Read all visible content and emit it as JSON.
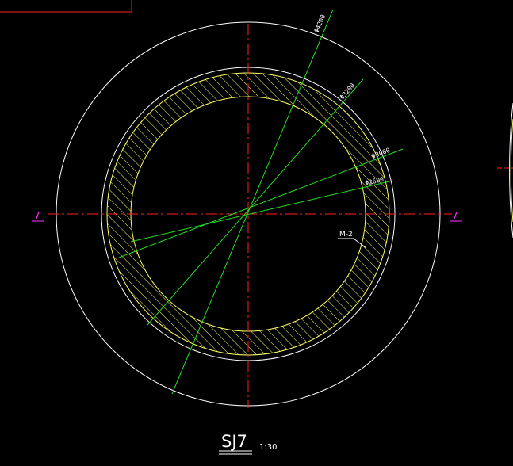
{
  "drawing": {
    "title": "SJ7",
    "scale": "1:30",
    "section_mark_left": "7",
    "section_mark_right": "7",
    "material_label": "M-2",
    "dimension_labels": [
      "Φ4200",
      "Φ3200",
      "Φ3000",
      "Φ2600"
    ]
  },
  "colors": {
    "background": "#000000",
    "circle_outline": "#ffffff",
    "wall_hatch": "#ffff66",
    "centerline": "#ff2020",
    "dimension_line": "#22dd22",
    "section_mark": "#ff33ff",
    "frame_box": "#ff2020"
  }
}
